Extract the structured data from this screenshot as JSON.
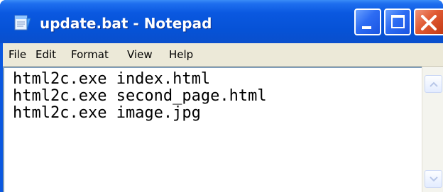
{
  "window": {
    "title": "update.bat - Notepad",
    "icon": "notepad-icon",
    "controls": {
      "minimize_icon": "minimize-icon",
      "maximize_icon": "maximize-icon",
      "close_icon": "close-icon"
    }
  },
  "menu": {
    "items": [
      "File",
      "Edit",
      "Format",
      "View",
      "Help"
    ]
  },
  "editor": {
    "lines": [
      "html2c.exe index.html",
      "html2c.exe second_page.html",
      "html2c.exe image.jpg"
    ]
  },
  "scrollbar": {
    "up_icon": "scroll-up-arrow-icon",
    "down_icon": "scroll-down-arrow-icon"
  },
  "colors": {
    "titlebar": "#0a58e0",
    "close_button": "#e05a33",
    "menubar": "#ece9d8",
    "editor_background": "#ffffff"
  }
}
